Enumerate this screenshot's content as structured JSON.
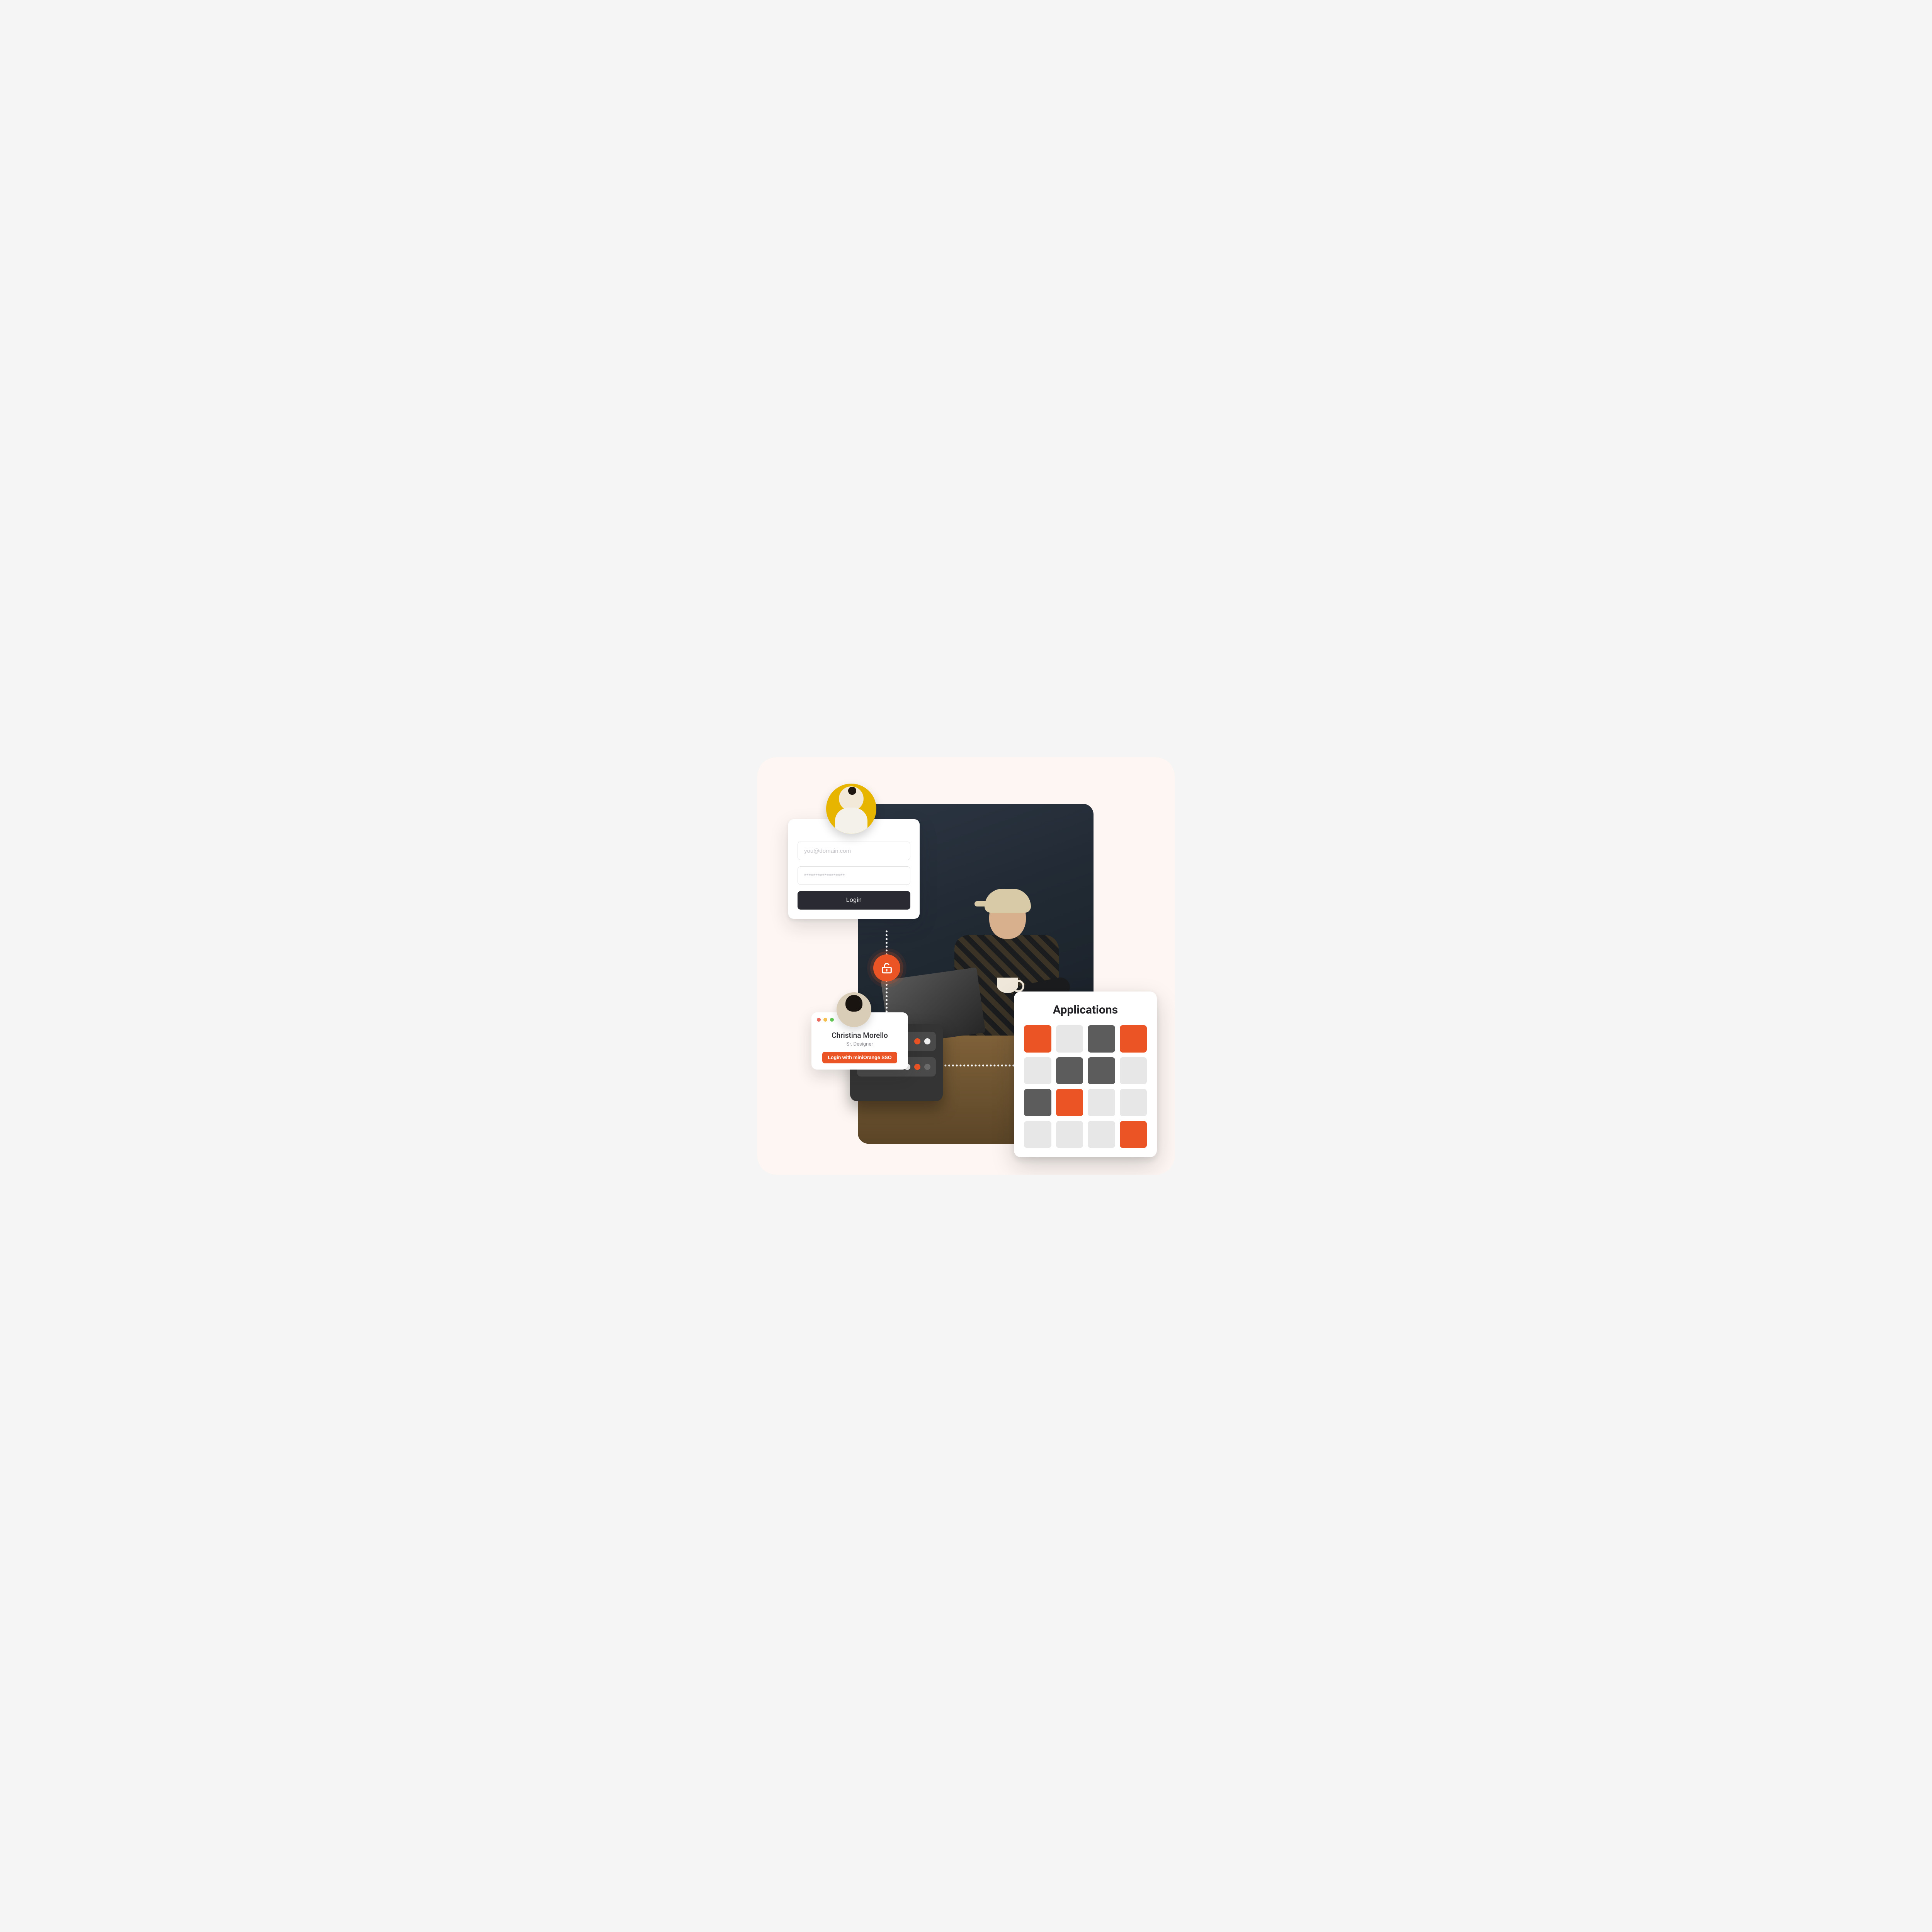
{
  "colors": {
    "accent": "#eb5424",
    "dark": "#2a2a32",
    "panel": "#ffffff",
    "bg": "#fdf6f2"
  },
  "login": {
    "email_placeholder": "you@domain.com",
    "password_placeholder": "******************",
    "button_label": "Login"
  },
  "unlock_icon": "unlock-icon",
  "user_card": {
    "name": "Christina Morello",
    "role": "Sr. Designer",
    "sso_button": "Login with miniOrange SSO"
  },
  "applications": {
    "title": "Applications",
    "grid": [
      "orange",
      "light",
      "grey",
      "orange",
      "light",
      "grey",
      "grey",
      "light",
      "grey",
      "orange",
      "light",
      "light",
      "light",
      "light",
      "light",
      "orange"
    ]
  }
}
